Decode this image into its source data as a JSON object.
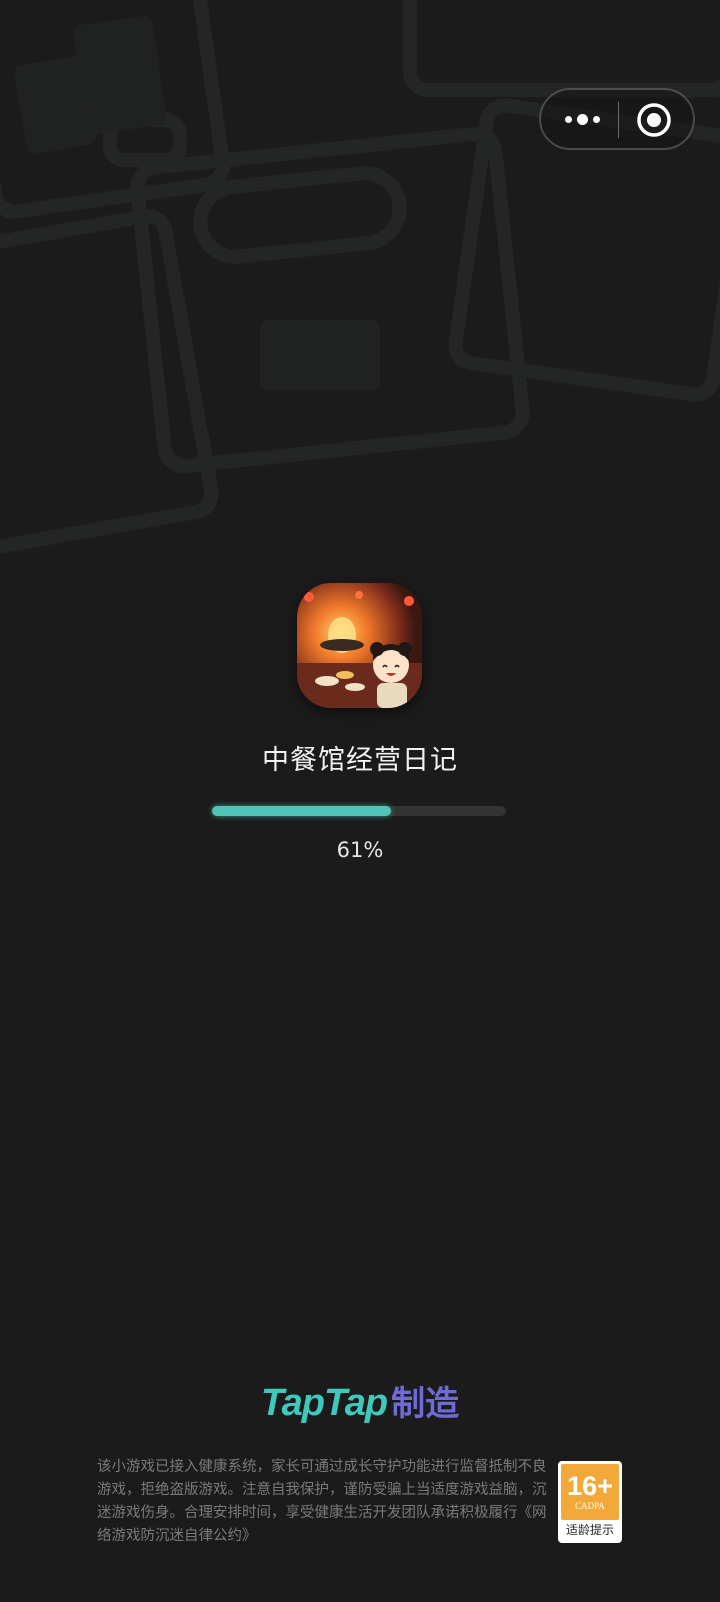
{
  "capsule": {
    "more_icon": "more-dots-icon",
    "close_icon": "circle-target-icon"
  },
  "app": {
    "title": "中餐馆经营日记",
    "icon": "restaurant-game-icon"
  },
  "loading": {
    "progress": 0.61,
    "progress_text": "61%"
  },
  "brand": {
    "tap": "TapTap",
    "made": "制造"
  },
  "notice": "该小游戏已接入健康系统，家长可通过成长守护功能进行监督抵制不良游戏，拒绝盗版游戏。注意自我保护，谨防受骗上当适度游戏益脑，沉迷游戏伤身。合理安排时间，享受健康生活开发团队承诺积极履行《网络游戏防沉迷自律公约》",
  "age_rating": {
    "number": "16+",
    "org": "CADPA",
    "tip": "适龄提示"
  },
  "colors": {
    "accent": "#4dc4b6",
    "brand_purple": "#6f6ad8",
    "badge": "#f3a93a",
    "background": "#1b1b1b"
  }
}
